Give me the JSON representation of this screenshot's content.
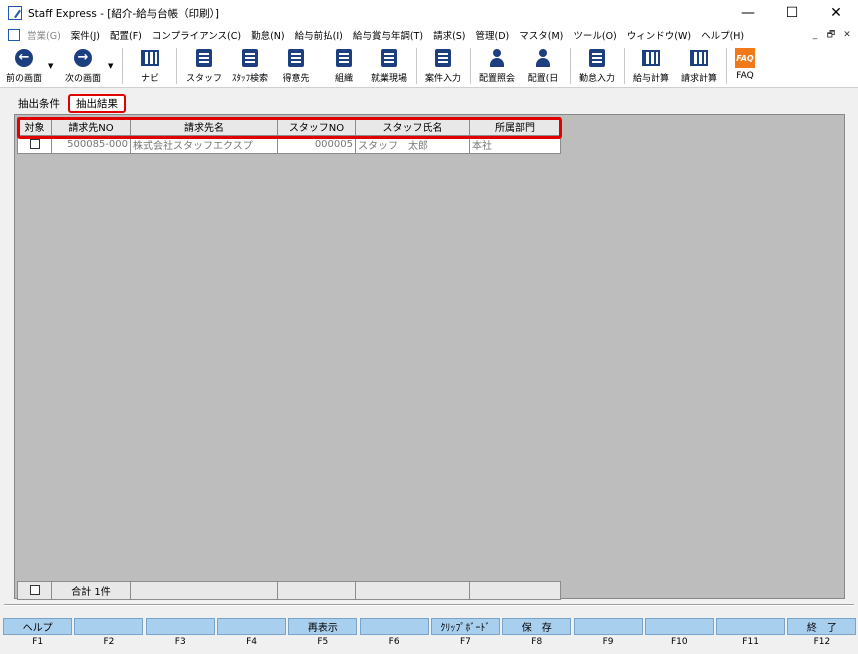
{
  "window": {
    "title": "Staff Express - [紹介-給与台帳（印刷）]",
    "controls": [
      "—",
      "☐",
      "✕"
    ]
  },
  "menu": {
    "items": [
      {
        "label": "営業(G)",
        "disabled": true
      },
      {
        "label": "案件(J)"
      },
      {
        "label": "配置(F)"
      },
      {
        "label": "コンプライアンス(C)"
      },
      {
        "label": "勤怠(N)"
      },
      {
        "label": "給与前払(I)"
      },
      {
        "label": "給与賞与年調(T)"
      },
      {
        "label": "請求(S)"
      },
      {
        "label": "管理(D)"
      },
      {
        "label": "マスタ(M)"
      },
      {
        "label": "ツール(O)"
      },
      {
        "label": "ウィンドウ(W)"
      },
      {
        "label": "ヘルプ(H)"
      }
    ],
    "mdi_controls": [
      "_",
      "🗗",
      "✕"
    ]
  },
  "toolbar": {
    "prev": "前の画面",
    "next": "次の画面",
    "navi": "ナビ",
    "staff": "スタッフ",
    "staff_search": "ｽﾀｯﾌ検索",
    "client": "得意先",
    "org": "組織",
    "worksite": "就業現場",
    "job_entry": "案件入力",
    "assign_inquiry": "配置照会",
    "assign_day": "配置(日",
    "attendance": "勤怠入力",
    "payroll": "給与計算",
    "billing": "請求計算",
    "faq": "FAQ",
    "faq_icon_text": "FAQ"
  },
  "tabs": {
    "conditions": "抽出条件",
    "results": "抽出結果"
  },
  "grid": {
    "headers": [
      "対象",
      "請求先NO",
      "請求先名",
      "スタッフNO",
      "スタッフ氏名",
      "所属部門"
    ],
    "rows": [
      {
        "client_no": "500085-000",
        "client_name": "株式会社スタッフエクスプ",
        "staff_no": "000005",
        "staff_name": "スタッフ　太郎",
        "dept": "本社"
      }
    ],
    "total": "合計  1件"
  },
  "fkeys": [
    {
      "key": "F1",
      "label": "ヘルプ"
    },
    {
      "key": "F2",
      "label": ""
    },
    {
      "key": "F3",
      "label": ""
    },
    {
      "key": "F4",
      "label": ""
    },
    {
      "key": "F5",
      "label": "再表示"
    },
    {
      "key": "F6",
      "label": ""
    },
    {
      "key": "F7",
      "label": "ｸﾘｯﾌﾟﾎﾞｰﾄﾞ"
    },
    {
      "key": "F8",
      "label": "保　存"
    },
    {
      "key": "F9",
      "label": ""
    },
    {
      "key": "F10",
      "label": ""
    },
    {
      "key": "F11",
      "label": ""
    },
    {
      "key": "F12",
      "label": "終　了"
    }
  ]
}
